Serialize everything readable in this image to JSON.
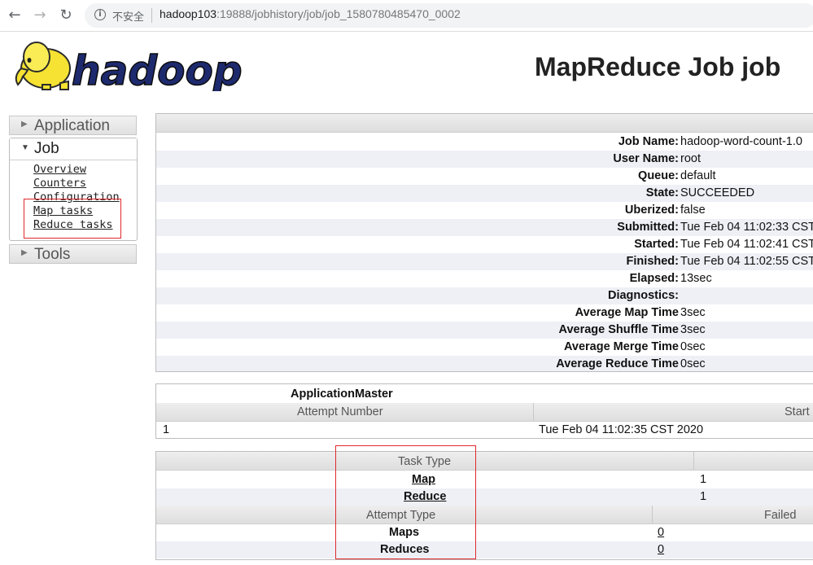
{
  "browser": {
    "insecure_label": "不安全",
    "url_host": "hadoop103",
    "url_rest": ":19888/jobhistory/job/job_1580780485470_0002"
  },
  "header": {
    "logo_text": "hadoop",
    "title": "MapReduce Job job"
  },
  "nav": {
    "application": "Application",
    "job": "Job",
    "links": [
      "Overview",
      "Counters",
      "Configuration",
      "Map tasks",
      "Reduce tasks"
    ],
    "tools": "Tools"
  },
  "job_info": {
    "rows": [
      {
        "key": "Job Name:",
        "value": "hadoop-word-count-1.0"
      },
      {
        "key": "User Name:",
        "value": "root"
      },
      {
        "key": "Queue:",
        "value": "default"
      },
      {
        "key": "State:",
        "value": "SUCCEEDED"
      },
      {
        "key": "Uberized:",
        "value": "false"
      },
      {
        "key": "Submitted:",
        "value": "Tue Feb 04 11:02:33 CST"
      },
      {
        "key": "Started:",
        "value": "Tue Feb 04 11:02:41 CST"
      },
      {
        "key": "Finished:",
        "value": "Tue Feb 04 11:02:55 CST"
      },
      {
        "key": "Elapsed:",
        "value": "13sec"
      },
      {
        "key": "Diagnostics:",
        "value": ""
      },
      {
        "key": "Average Map Time",
        "value": "3sec"
      },
      {
        "key": "Average Shuffle Time",
        "value": "3sec"
      },
      {
        "key": "Average Merge Time",
        "value": "0sec"
      },
      {
        "key": "Average Reduce Time",
        "value": "0sec"
      }
    ]
  },
  "app_master": {
    "title": "ApplicationMaster",
    "col_attempt": "Attempt Number",
    "col_start": "Start",
    "attempt_number": "1",
    "start_time": "Tue Feb 04 11:02:35 CST 2020"
  },
  "tasks": {
    "col_task_type": "Task Type",
    "map_label": "Map",
    "map_total": "1",
    "reduce_label": "Reduce",
    "reduce_total": "1",
    "col_attempt_type": "Attempt Type",
    "col_failed": "Failed",
    "maps_label": "Maps",
    "maps_failed": "0",
    "reduces_label": "Reduces",
    "reduces_failed": "0"
  }
}
